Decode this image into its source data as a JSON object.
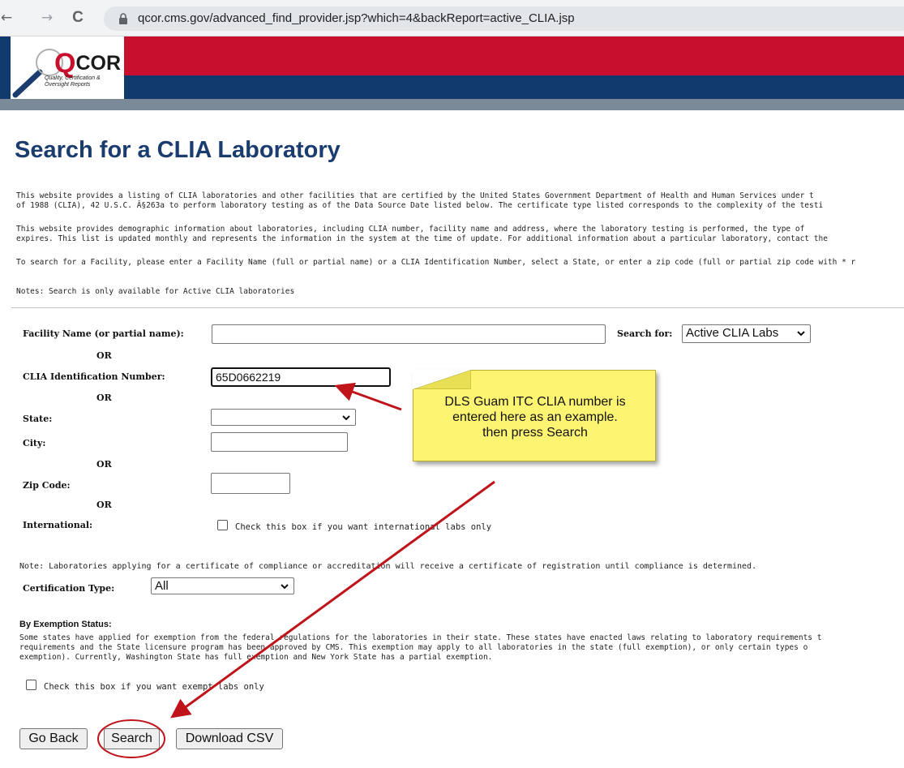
{
  "browser": {
    "back_icon": "←",
    "forward_icon": "→",
    "reload_icon": "C",
    "url": "qcor.cms.gov/advanced_find_provider.jsp?which=4&backReport=active_CLIA.jsp"
  },
  "logo": {
    "q": "Q",
    "name": "COR",
    "subtitle": "Quality, Certification & Oversight Reports"
  },
  "colors": {
    "brand_red": "#c8102e",
    "brand_blue": "#103a6b",
    "title_blue": "#1a3c6e",
    "callout_yellow": "#fdf472",
    "arrow_red": "#c0141b"
  },
  "page": {
    "title": "Search for a CLIA Laboratory",
    "intro_line1": "This website provides a listing of CLIA laboratories and other facilities that are certified by the United States Government Department of Health and Human Services under t",
    "intro_line2": "of 1988 (CLIA), 42 U.S.C. Â§263a to perform laboratory testing as of the Data Source Date listed below. The certificate type listed corresponds to the complexity of the testi",
    "demo_line1": "This website provides demographic information about laboratories, including CLIA number, facility name and address, where the laboratory testing is performed, the type of",
    "demo_line2": "expires. This list is updated monthly and represents the information in the system at the time of update. For additional information about a particular laboratory, contact the",
    "instructions": "To search for a Facility, please enter a Facility Name (full or partial name) or a CLIA Identification Number, select a State, or enter a zip code (full or partial zip code with * r",
    "notes": "Notes: Search is only available for Active CLIA laboratories"
  },
  "form": {
    "facility_label": "Facility Name (or partial name):",
    "facility_value": "",
    "search_for_label": "Search for:",
    "search_for_value": "Active CLIA Labs",
    "or_label": "OR",
    "clia_label": "CLIA Identification Number:",
    "clia_value": "65D0662219",
    "state_label": "State:",
    "state_value": "",
    "city_label": "City:",
    "city_value": "",
    "zip_label": "Zip Code:",
    "zip_value": "",
    "international_label": "International:",
    "international_checkbox_text": "Check this box if you want international labs only",
    "cert_note": "Note: Laboratories applying for a certificate of compliance or accreditation will receive a certificate of registration until compliance is determined.",
    "cert_type_label": "Certification Type:",
    "cert_type_value": "All",
    "exemption_heading": "By Exemption Status:",
    "exemption_line1": "Some states have applied for exemption from the federal regulations for the laboratories in their state. These states have enacted laws relating to laboratory requirements t",
    "exemption_line2": "requirements and the State licensure program has been approved by CMS. This exemption may apply to all laboratories in the state (full exemption), or only certain types o",
    "exemption_line3": "exemption). Currently, Washington State has full exemption and New York State has a partial exemption.",
    "exempt_checkbox_text": "Check this box if you want exempt labs only"
  },
  "buttons": {
    "go_back": "Go Back",
    "search": "Search",
    "download_csv": "Download CSV"
  },
  "callout": {
    "line1": "DLS Guam ITC CLIA number is",
    "line2": "entered here as an example.",
    "line3": "then press Search"
  }
}
